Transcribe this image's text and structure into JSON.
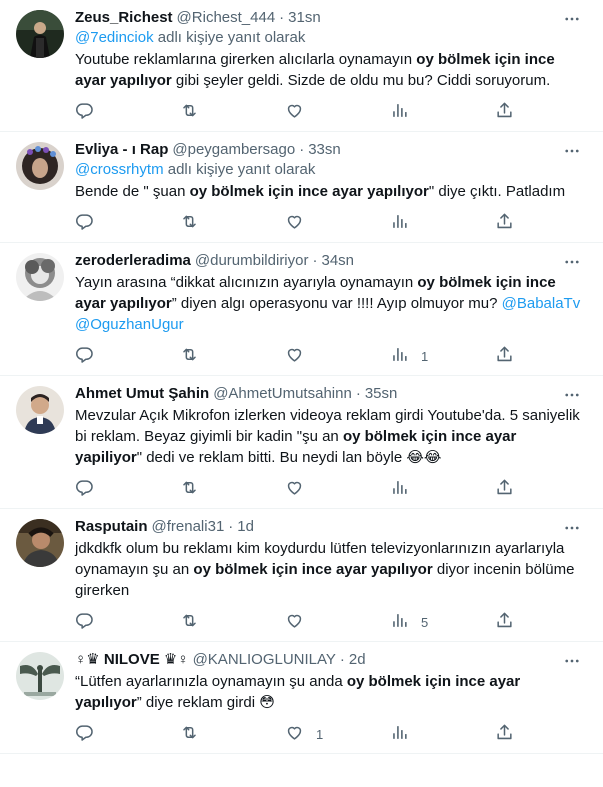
{
  "tweets": [
    {
      "name": "Zeus_Richest",
      "handle": "@Richest_444",
      "time": "31sn",
      "reply_handle": "@7edinciok",
      "reply_suffix": "adlı kişiye yanıt olarak",
      "parts": [
        {
          "t": "Youtube reklamlarına girerken alıcılarla oynamayın "
        },
        {
          "t": "oy bölmek için ince ayar yapılıyor",
          "b": true
        },
        {
          "t": " gibi şeyler geldi. Sizde de oldu mu bu? Ciddi soruyorum."
        }
      ],
      "views": "",
      "likes": ""
    },
    {
      "name": "Evliya - ı Rap",
      "handle": "@peygambersago",
      "time": "33sn",
      "reply_handle": "@crossrhytm",
      "reply_suffix": "adlı kişiye yanıt olarak",
      "parts": [
        {
          "t": "Bende de \" şuan "
        },
        {
          "t": "oy bölmek için ince ayar yapılıyor",
          "b": true
        },
        {
          "t": "\" diye çıktı. Patladım"
        }
      ],
      "views": "",
      "likes": ""
    },
    {
      "name": "zeroderleradima",
      "handle": "@durumbildiriyor",
      "time": "34sn",
      "reply_handle": "",
      "reply_suffix": "",
      "parts": [
        {
          "t": "Yayın arasına “dikkat alıcınızın ayarıyla oynamayın "
        },
        {
          "t": "oy bölmek için ince ayar yapılıyor",
          "b": true
        },
        {
          "t": "” diyen algı operasyonu  var !!!! Ayıp olmuyor mu? "
        },
        {
          "t": "@BabalaTv @OguzhanUgur",
          "m": true
        }
      ],
      "views": "1",
      "likes": ""
    },
    {
      "name": "Ahmet Umut Şahin",
      "handle": "@AhmetUmutsahinn",
      "time": "35sn",
      "reply_handle": "",
      "reply_suffix": "",
      "parts": [
        {
          "t": "Mevzular Açık Mikrofon izlerken videoya reklam girdi Youtube'da. 5 saniyelik bi reklam. Beyaz giyimli bir kadin \"şu an "
        },
        {
          "t": "oy bölmek için ince ayar yapiliyor",
          "b": true
        },
        {
          "t": "\" dedi ve reklam bitti.  Bu neydi lan böyle 😂😂"
        }
      ],
      "views": "",
      "likes": ""
    },
    {
      "name": "Rasputain",
      "handle": "@frenali31",
      "time": "1d",
      "reply_handle": "",
      "reply_suffix": "",
      "parts": [
        {
          "t": "jdkdkfk olum bu reklamı kim koydurdu lütfen televizyonlarınızın ayarlarıyla oynamayın şu an "
        },
        {
          "t": "oy bölmek için ince ayar yapılıyor",
          "b": true
        },
        {
          "t": " diyor incenin bölüme girerken"
        }
      ],
      "views": "5",
      "likes": ""
    },
    {
      "name": "♀♛ NILOVE ♛♀",
      "handle": "@KANLIOGLUNILAY",
      "time": "2d",
      "reply_handle": "",
      "reply_suffix": "",
      "parts": [
        {
          "t": "“Lütfen ayarlarınızla oynamayın şu anda "
        },
        {
          "t": "oy bölmek için ince ayar yapılıyor",
          "b": true
        },
        {
          "t": "” diye reklam girdi 😳"
        }
      ],
      "views": "",
      "likes": "1"
    }
  ],
  "colors": {
    "text": "#0f1419",
    "muted": "#536471",
    "link": "#1d9bf0",
    "divider": "#eff3f4"
  },
  "icons": [
    "more-icon",
    "reply-icon",
    "retweet-icon",
    "like-icon",
    "views-icon",
    "share-icon"
  ]
}
